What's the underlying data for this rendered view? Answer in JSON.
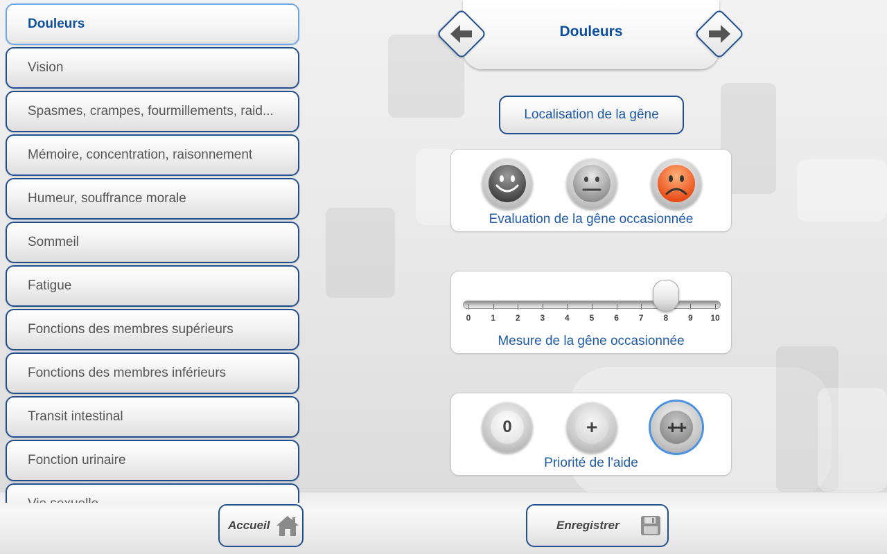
{
  "sidebar": {
    "items": [
      {
        "label": "Douleurs",
        "active": true
      },
      {
        "label": "Vision"
      },
      {
        "label": "Spasmes, crampes, fourmillements, raid..."
      },
      {
        "label": "Mémoire, concentration, raisonnement"
      },
      {
        "label": "Humeur, souffrance morale"
      },
      {
        "label": "Sommeil"
      },
      {
        "label": "Fatigue"
      },
      {
        "label": "Fonctions des membres supérieurs"
      },
      {
        "label": "Fonctions des membres inférieurs"
      },
      {
        "label": "Transit intestinal"
      },
      {
        "label": "Fonction urinaire"
      },
      {
        "label": "Vie sexuelle"
      }
    ]
  },
  "header": {
    "title": "Douleurs",
    "prev_icon": "arrow-left-icon",
    "next_icon": "arrow-right-icon"
  },
  "localisation": {
    "label": "Localisation de la gêne"
  },
  "evaluation": {
    "label": "Evaluation de la gêne occasionnée",
    "options": [
      "happy-face-icon",
      "neutral-face-icon",
      "sad-face-icon"
    ],
    "selected": "sad-face-icon"
  },
  "mesure": {
    "label": "Mesure de la gêne occasionnée",
    "ticks": [
      "0",
      "1",
      "2",
      "3",
      "4",
      "5",
      "6",
      "7",
      "8",
      "9",
      "10"
    ],
    "value": 8
  },
  "priorite": {
    "label": "Priorité de l'aide",
    "options": [
      "0",
      "+",
      "++"
    ],
    "selected": "++"
  },
  "footer": {
    "accueil_label": "Accueil",
    "enregistrer_label": "Enregistrer"
  },
  "colors": {
    "accent": "#0b4f9e",
    "border": "#1f4f8f",
    "sad_orange": "#f05a1a"
  }
}
